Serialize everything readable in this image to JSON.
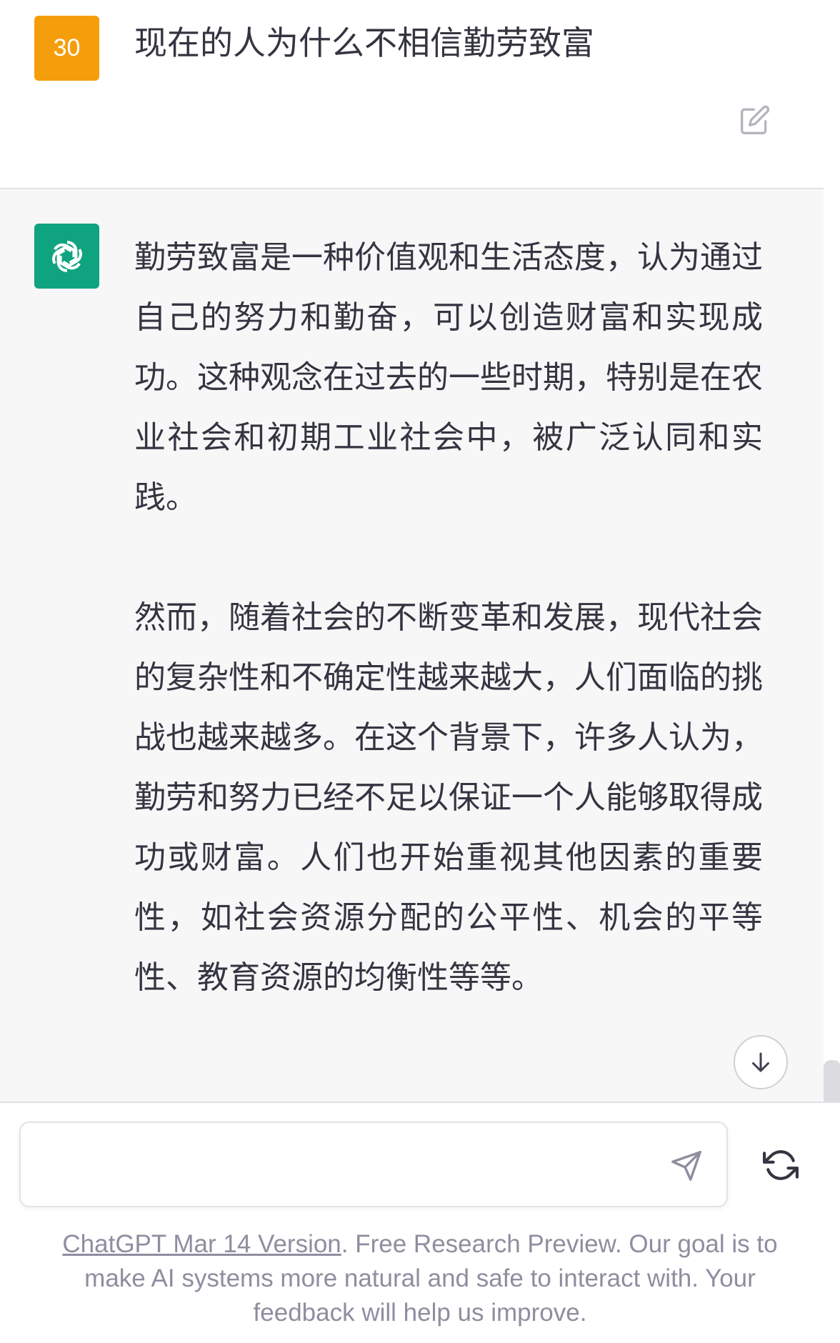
{
  "user_message": {
    "avatar_text": "30",
    "avatar_color": "#f59e0b",
    "text": "现在的人为什么不相信勤劳致富"
  },
  "assistant_message": {
    "avatar_color": "#10a37f",
    "paragraphs": [
      "勤劳致富是一种价值观和生活态度，认为通过自己的努力和勤奋，可以创造财富和实现成功。这种观念在过去的一些时期，特别是在农业社会和初期工业社会中，被广泛认同和实践。",
      "然而，随着社会的不断变革和发展，现代社会的复杂性和不确定性越来越大，人们面临的挑战也越来越多。在这个背景下，许多人认为，勤劳和努力已经不足以保证一个人能够取得成功或财富。人们也开始重视其他因素的重要性，如社会资源分配的公平性、机会的平等性、教育资源的均衡性等等。"
    ]
  },
  "input": {
    "value": "",
    "placeholder": ""
  },
  "icons": {
    "edit": "edit-icon",
    "openai_logo": "openai-logo-icon",
    "scroll_down": "arrow-down-icon",
    "send": "send-icon",
    "regenerate": "regenerate-icon"
  },
  "footer": {
    "link_text": "ChatGPT Mar 14 Version",
    "text": ". Free Research Preview. Our goal is to make AI systems more natural and safe to interact with. Your feedback will help us improve."
  }
}
